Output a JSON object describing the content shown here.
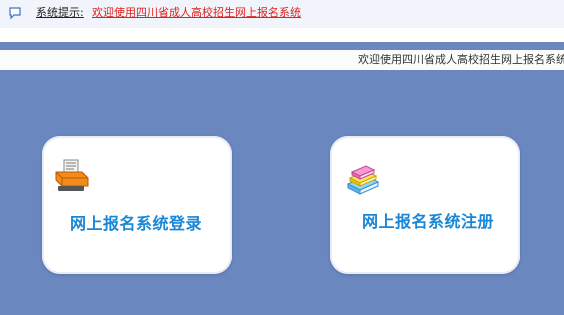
{
  "notice": {
    "label": "系统提示:",
    "message": "欢迎使用四川省成人高校招生网上报名系统"
  },
  "marquee": {
    "text": "欢迎使用四川省成人高校招生网上报名系统"
  },
  "cards": {
    "login": {
      "label": "网上报名系统登录",
      "icon": "printer-icon"
    },
    "register": {
      "label": "网上报名系统注册",
      "icon": "books-icon"
    }
  },
  "colors": {
    "background": "#6a87c0",
    "notice_text": "#e0201b",
    "card_label": "#1a86d6"
  }
}
